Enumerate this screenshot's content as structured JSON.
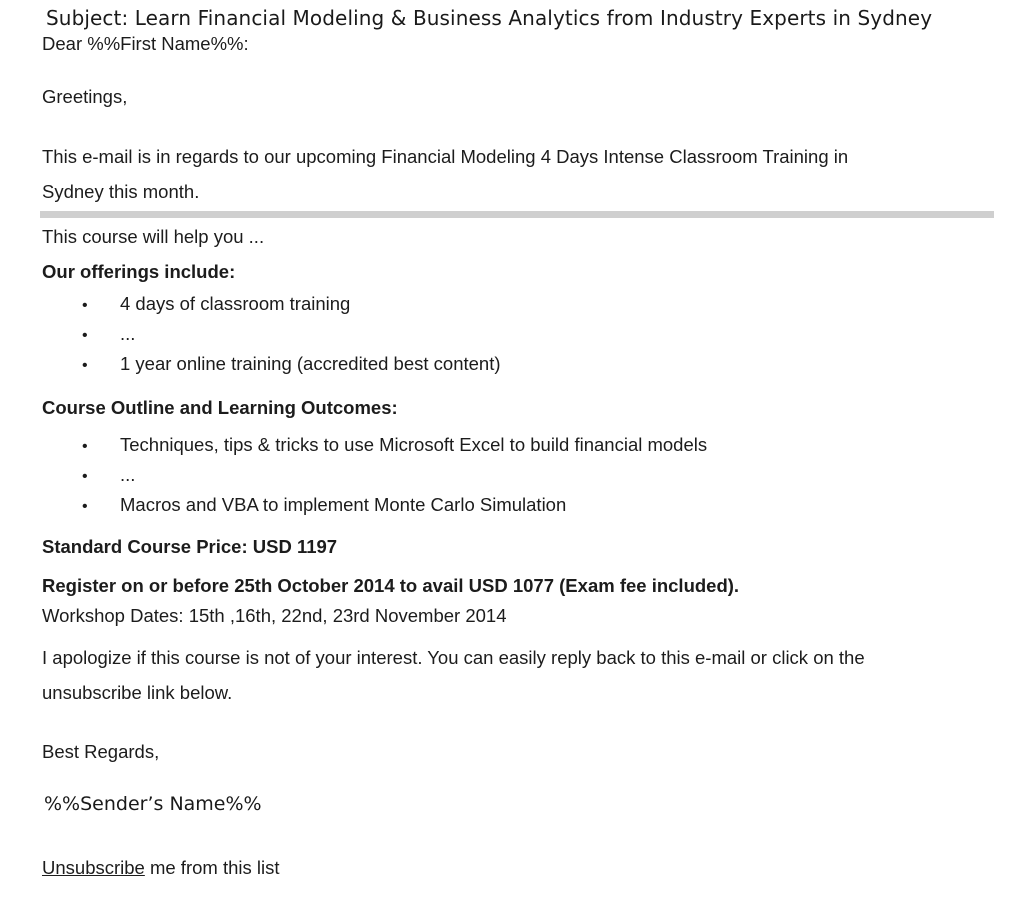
{
  "subject": "Subject: Learn Financial Modeling & Business Analytics from Industry Experts in Sydney",
  "greeting_name": "Dear %%First Name%%:",
  "greeting": "Greetings,",
  "intro_line1": "This e-mail is in regards to our upcoming Financial Modeling 4 Days Intense Classroom Training in",
  "intro_line2": "Sydney this month.",
  "course_help": "This course will help you ...",
  "offerings": {
    "heading": "Our offerings include:",
    "items": [
      "4 days of classroom training",
      "...",
      "1 year online training (accredited best content)"
    ]
  },
  "outline": {
    "heading": "Course Outline and Learning Outcomes:",
    "items": [
      "Techniques, tips & tricks to use Microsoft Excel to build financial models",
      "...",
      "Macros and VBA to implement Monte Carlo Simulation"
    ]
  },
  "bullet_glyph": "•",
  "price": "Standard Course Price: USD 1197",
  "register": "Register on or before 25th October 2014 to avail USD 1077 (Exam fee included).",
  "dates": "Workshop Dates: 15th ,16th, 22nd, 23rd November 2014",
  "apology_line1": "I apologize if this course is not of your interest. You can easily reply back to this e-mail or click on the",
  "apology_line2": "unsubscribe link below.",
  "regards": "Best Regards,",
  "sender": "%%Sender’s Name%%",
  "unsubscribe": {
    "link_text": "Unsubscribe",
    "rest_text": " me from this list"
  }
}
